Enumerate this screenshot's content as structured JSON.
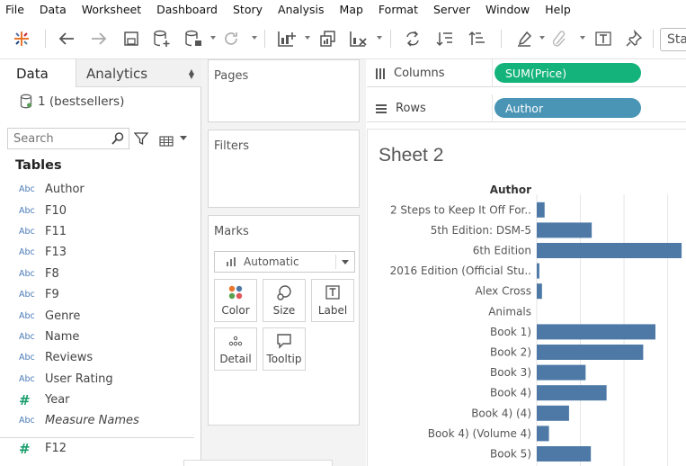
{
  "menu": [
    "File",
    "Data",
    "Worksheet",
    "Dashboard",
    "Story",
    "Analysis",
    "Map",
    "Format",
    "Server",
    "Window",
    "Help"
  ],
  "toolbar": {
    "show_me_label": "Sta"
  },
  "left_pane": {
    "tab_data": "Data",
    "tab_analytics": "Analytics",
    "datasource": "1 (bestsellers)",
    "search_placeholder": "Search",
    "tables_heading": "Tables",
    "fields": [
      {
        "type": "Abc",
        "name": "Author"
      },
      {
        "type": "Abc",
        "name": "F10"
      },
      {
        "type": "Abc",
        "name": "F11"
      },
      {
        "type": "Abc",
        "name": "F13"
      },
      {
        "type": "Abc",
        "name": "F8"
      },
      {
        "type": "Abc",
        "name": "F9"
      },
      {
        "type": "Abc",
        "name": "Genre"
      },
      {
        "type": "Abc",
        "name": "Name"
      },
      {
        "type": "Abc",
        "name": "Reviews"
      },
      {
        "type": "Abc",
        "name": "User Rating"
      },
      {
        "type": "#",
        "name": "Year"
      },
      {
        "type": "Abc",
        "name": "Measure Names"
      }
    ],
    "extra_field": {
      "type": "#",
      "name": "F12"
    }
  },
  "cards": {
    "pages_title": "Pages",
    "filters_title": "Filters",
    "marks_title": "Marks",
    "marks_type": "Automatic",
    "buttons": {
      "color": "Color",
      "size": "Size",
      "label": "Label",
      "detail": "Detail",
      "tooltip": "Tooltip"
    }
  },
  "shelves": {
    "columns_label": "Columns",
    "columns_pill": "SUM(Price)",
    "rows_label": "Rows",
    "rows_pill": "Author"
  },
  "colors": {
    "columns_pill": "#15b37c",
    "rows_pill": "#4a94b5",
    "bar": "#4e79a7",
    "gridline": "#e6e6e6"
  },
  "sheet": {
    "title": "Sheet 2",
    "axis_header": "Author"
  },
  "chart_data": {
    "type": "bar",
    "orientation": "horizontal",
    "categories": [
      "2 Steps to Keep It Off For..",
      "5th Edition: DSM-5",
      "6th Edition",
      "2016 Edition (Official Stu..",
      "Alex Cross",
      "Animals",
      "Book 1)",
      "Book 2)",
      "Book 3)",
      "Book 4)",
      "Book 4) (4)",
      "Book 4) (Volume 4)",
      "Book 5)"
    ],
    "values": [
      9,
      63,
      166,
      3,
      6,
      0,
      136,
      122,
      56,
      80,
      37,
      14,
      62
    ],
    "xlim": [
      0,
      170
    ],
    "grid": true
  }
}
